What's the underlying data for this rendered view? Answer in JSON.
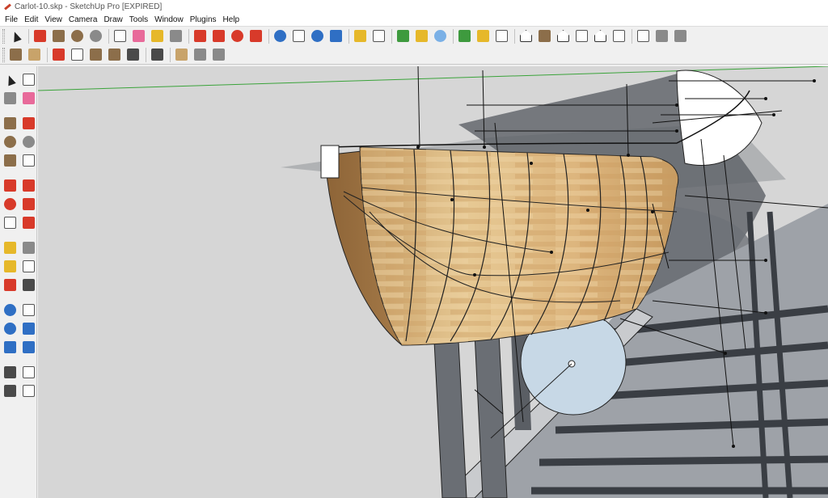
{
  "window": {
    "title": "Carlot-10.skp - SketchUp Pro [EXPIRED]"
  },
  "menu": [
    "File",
    "Edit",
    "View",
    "Camera",
    "Draw",
    "Tools",
    "Window",
    "Plugins",
    "Help"
  ],
  "toolbar_row1": [
    {
      "name": "select-icon",
      "style": "arrow"
    },
    "sep",
    {
      "name": "line-icon",
      "style": "red"
    },
    {
      "name": "rectangle-icon",
      "style": "brown"
    },
    {
      "name": "circle-icon",
      "style": "brown circle"
    },
    {
      "name": "arc-icon",
      "style": "gray circle"
    },
    "sep",
    {
      "name": "make-component-icon",
      "style": "white"
    },
    {
      "name": "eraser-icon",
      "style": "pink"
    },
    {
      "name": "tape-measure-icon",
      "style": "yellow"
    },
    {
      "name": "paint-bucket-icon",
      "style": "gray"
    },
    "sep",
    {
      "name": "push-pull-icon",
      "style": "red"
    },
    {
      "name": "move-icon",
      "style": "red"
    },
    {
      "name": "rotate-icon",
      "style": "red circle"
    },
    {
      "name": "offset-icon",
      "style": "red"
    },
    "sep",
    {
      "name": "orbit-icon",
      "style": "blue circle"
    },
    {
      "name": "pan-icon",
      "style": "white"
    },
    {
      "name": "zoom-icon",
      "style": "blue circle"
    },
    {
      "name": "zoom-extents-icon",
      "style": "blue"
    },
    "sep",
    {
      "name": "get-models-icon",
      "style": "yellow"
    },
    {
      "name": "share-model-icon",
      "style": "white"
    },
    "sep",
    {
      "name": "add-location-icon",
      "style": "green"
    },
    {
      "name": "toggle-terrain-icon",
      "style": "yellow"
    },
    {
      "name": "preview-google-earth-icon",
      "style": "lblue circle"
    },
    "sep",
    {
      "name": "components-icon",
      "style": "green"
    },
    {
      "name": "extension-warehouse-icon",
      "style": "yellow"
    },
    {
      "name": "layout-icon",
      "style": "white"
    },
    "sep",
    {
      "name": "iso-view-icon",
      "style": "house"
    },
    {
      "name": "top-view-icon",
      "style": "brown"
    },
    {
      "name": "front-view-icon",
      "style": "house"
    },
    {
      "name": "right-view-icon",
      "style": "white"
    },
    {
      "name": "back-view-icon",
      "style": "house"
    },
    {
      "name": "left-view-icon",
      "style": "white"
    },
    "sep",
    {
      "name": "walk-icon",
      "style": "white"
    },
    {
      "name": "position-camera-icon",
      "style": "gray"
    },
    {
      "name": "look-around-icon",
      "style": "gray"
    }
  ],
  "toolbar_row2": [
    {
      "name": "section-plane-icon",
      "style": "brown"
    },
    {
      "name": "section-cut-icon",
      "style": "tan"
    },
    "sep",
    {
      "name": "xray-icon",
      "style": "red"
    },
    {
      "name": "wireframe-icon",
      "style": "white"
    },
    {
      "name": "hidden-line-icon",
      "style": "brown"
    },
    {
      "name": "shaded-icon",
      "style": "brown"
    },
    {
      "name": "shaded-textures-icon",
      "style": "dgray"
    },
    "sep",
    {
      "name": "monochrome-icon",
      "style": "dgray"
    },
    "sep",
    {
      "name": "sandbox-icon",
      "style": "tan"
    },
    {
      "name": "sandbox-scratch-icon",
      "style": "gray"
    },
    {
      "name": "sandbox-smoove-icon",
      "style": "gray"
    }
  ],
  "left_toolbar": [
    {
      "name": "select-icon",
      "style": "arrow"
    },
    {
      "name": "make-component-icon",
      "style": "white"
    },
    {
      "name": "paint-bucket-icon",
      "style": "gray"
    },
    {
      "name": "eraser-icon",
      "style": "pink"
    },
    "gap",
    {
      "name": "rectangle-icon",
      "style": "brown"
    },
    {
      "name": "line-icon",
      "style": "red"
    },
    {
      "name": "circle-icon",
      "style": "brown circle"
    },
    {
      "name": "arc-icon",
      "style": "gray circle"
    },
    {
      "name": "polygon-icon",
      "style": "brown"
    },
    {
      "name": "freehand-icon",
      "style": "white"
    },
    "gap",
    {
      "name": "move-icon",
      "style": "red"
    },
    {
      "name": "push-pull-icon",
      "style": "red"
    },
    {
      "name": "rotate-icon",
      "style": "red circle"
    },
    {
      "name": "follow-me-icon",
      "style": "red"
    },
    {
      "name": "scale-icon",
      "style": "white"
    },
    {
      "name": "offset-icon",
      "style": "red"
    },
    "gap",
    {
      "name": "tape-measure-icon",
      "style": "yellow"
    },
    {
      "name": "dimension-icon",
      "style": "gray"
    },
    {
      "name": "protractor-icon",
      "style": "yellow"
    },
    {
      "name": "text-icon",
      "style": "white"
    },
    {
      "name": "axes-icon",
      "style": "red"
    },
    {
      "name": "3d-text-icon",
      "style": "dgray"
    },
    "gap",
    {
      "name": "orbit-icon",
      "style": "blue circle"
    },
    {
      "name": "pan-icon",
      "style": "white"
    },
    {
      "name": "zoom-icon",
      "style": "blue circle"
    },
    {
      "name": "zoom-extents-icon",
      "style": "blue"
    },
    {
      "name": "zoom-window-icon",
      "style": "blue"
    },
    {
      "name": "previous-view-icon",
      "style": "blue"
    },
    "gap",
    {
      "name": "position-camera-icon",
      "style": "dgray"
    },
    {
      "name": "look-around-icon",
      "style": "white"
    },
    {
      "name": "walk-icon",
      "style": "dgray"
    },
    {
      "name": "section-plane-icon",
      "style": "white"
    }
  ],
  "colors": {
    "viewport_bg": "#d6d6d6",
    "wood_light": "#e2c28e",
    "wood_dark": "#a37a4a",
    "shadow_gray": "#5c6066",
    "ghost_plane": "#a9abae",
    "bulkhead_fill": "#c7d8e6",
    "green_axis": "#3aa33a"
  }
}
